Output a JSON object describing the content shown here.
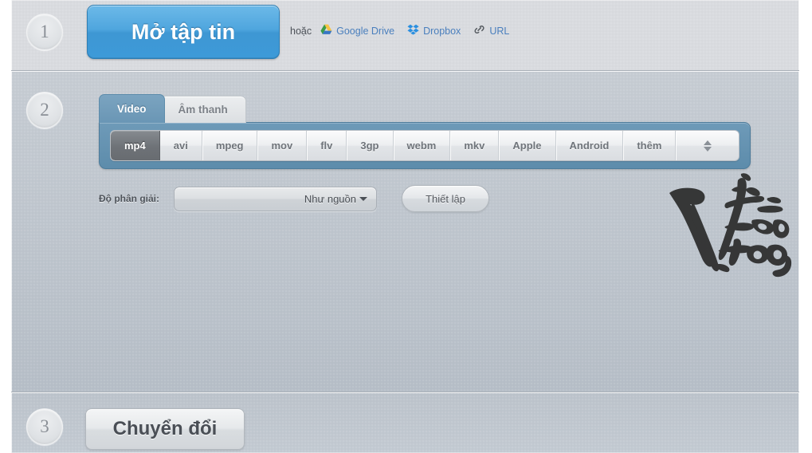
{
  "steps": {
    "one": "1",
    "two": "2",
    "three": "3"
  },
  "step1": {
    "open_file_label": "Mở tập tin",
    "or_label": "hoặc",
    "sources": [
      {
        "label": "Google Drive",
        "icon": "google-drive-icon"
      },
      {
        "label": "Dropbox",
        "icon": "dropbox-icon"
      },
      {
        "label": "URL",
        "icon": "link-icon"
      }
    ]
  },
  "step2": {
    "tabs": [
      {
        "label": "Video",
        "active": true
      },
      {
        "label": "Âm thanh",
        "active": false
      }
    ],
    "formats": [
      {
        "label": "mp4",
        "selected": true
      },
      {
        "label": "avi",
        "selected": false
      },
      {
        "label": "mpeg",
        "selected": false
      },
      {
        "label": "mov",
        "selected": false
      },
      {
        "label": "flv",
        "selected": false
      },
      {
        "label": "3gp",
        "selected": false
      },
      {
        "label": "webm",
        "selected": false
      },
      {
        "label": "mkv",
        "selected": false
      },
      {
        "label": "Apple",
        "selected": false
      },
      {
        "label": "Android",
        "selected": false
      },
      {
        "label": "thêm",
        "selected": false
      }
    ],
    "resolution_label": "Độ phân giải:",
    "resolution_value": "Như nguồn",
    "settings_label": "Thiết lập"
  },
  "step3": {
    "convert_label": "Chuyển đổi"
  },
  "watermark": {
    "text": "Việt Gia Trang",
    "icon": "calligraphy-watermark"
  },
  "colors": {
    "accent_blue": "#4fa6de",
    "panel_blue": "#5d8cab",
    "tab_active_blue": "#6a96b5",
    "link_blue": "#4a7fbd",
    "selected_format_gray": "#6e7277",
    "page_background": "#b6bec7",
    "top_band": "#d9dbdf"
  }
}
